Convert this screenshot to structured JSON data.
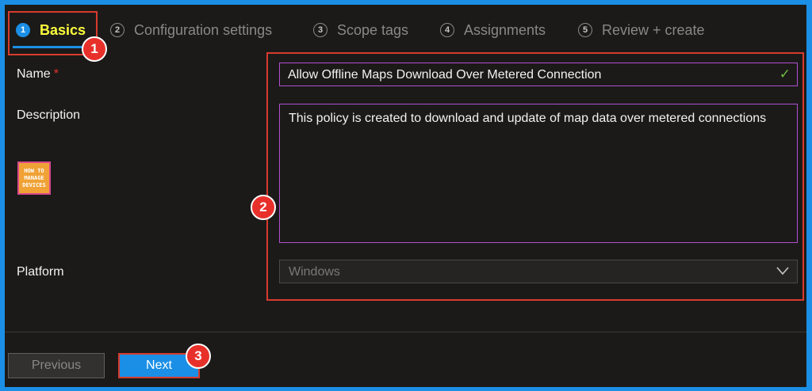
{
  "tabs": [
    {
      "num": "1",
      "label": "Basics"
    },
    {
      "num": "2",
      "label": "Configuration settings"
    },
    {
      "num": "3",
      "label": "Scope tags"
    },
    {
      "num": "4",
      "label": "Assignments"
    },
    {
      "num": "5",
      "label": "Review + create"
    }
  ],
  "active_tab": "Basics",
  "form": {
    "name_label": "Name",
    "required_mark": "*",
    "name_value": "Allow Offline Maps Download Over Metered Connection",
    "description_label": "Description",
    "description_value": "This policy is created to download and update of map data over metered connections",
    "platform_label": "Platform",
    "platform_value": "Windows"
  },
  "logo": {
    "line1": "HOW TO",
    "line2": "MANAGE",
    "line3": "DEVICES"
  },
  "annotations": {
    "badge1": "1",
    "badge2": "2",
    "badge3": "3"
  },
  "footer": {
    "previous_label": "Previous",
    "next_label": "Next"
  },
  "colors": {
    "accent": "#1b8fe6",
    "annotation_red": "#e8302a",
    "active_tab_text": "#ffff3c",
    "focus_border": "#b24fd3"
  }
}
